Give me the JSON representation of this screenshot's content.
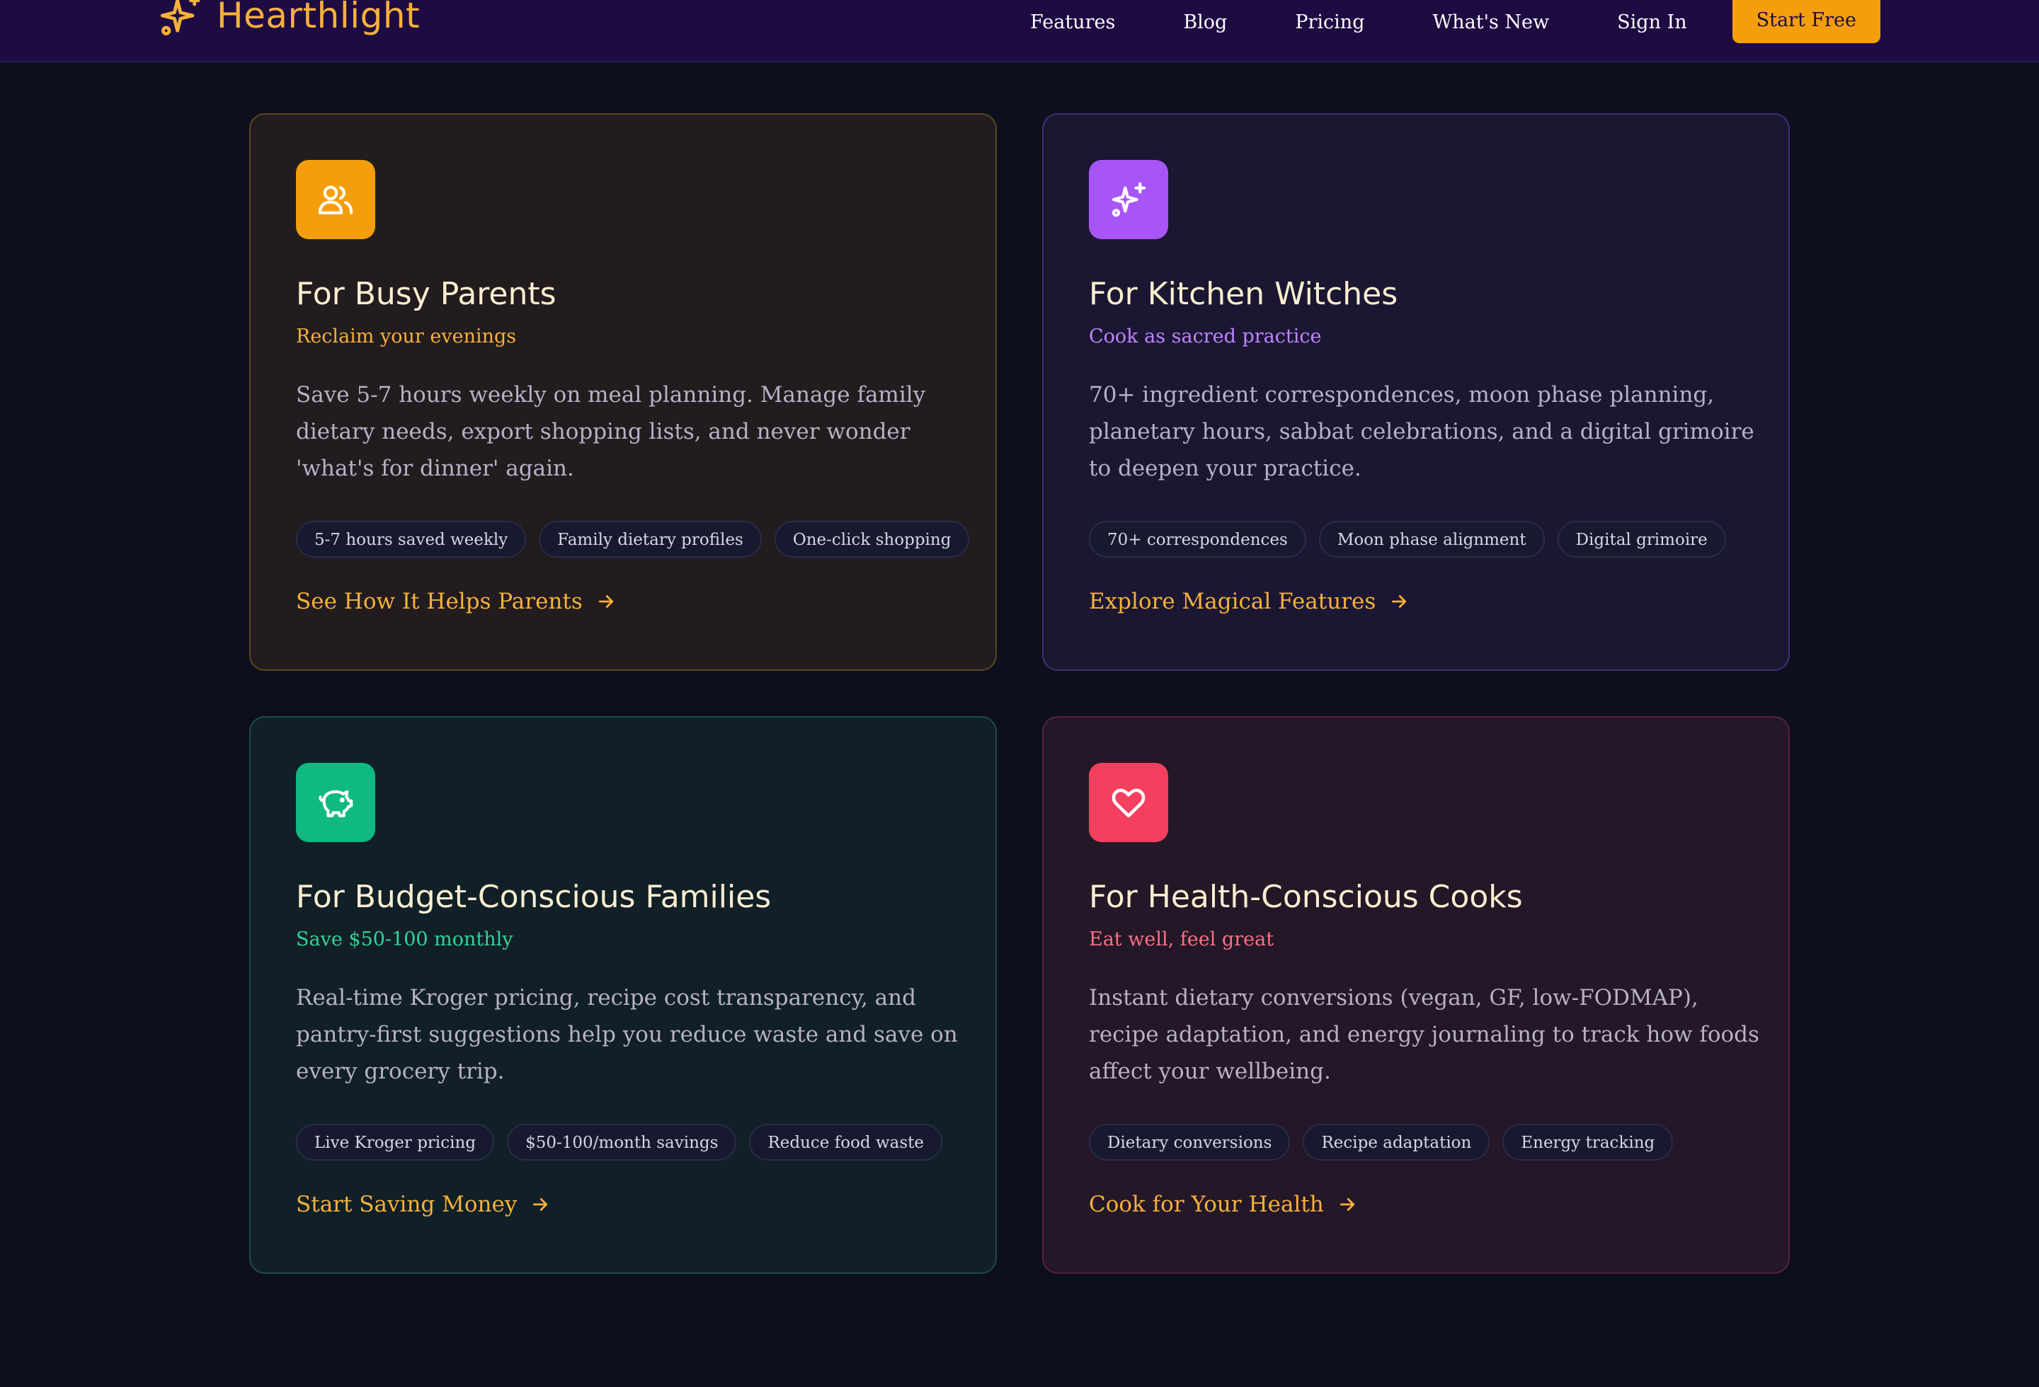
{
  "brand": {
    "name": "Hearthlight",
    "icon": "sparkle-icon",
    "color": "#f6b13a"
  },
  "nav": {
    "links": [
      "Features",
      "Blog",
      "Pricing",
      "What's New",
      "Sign In"
    ],
    "cta_label": "Start Free"
  },
  "colors": {
    "background": "#0d0f1f",
    "nav_background": "#1e0b42",
    "accent": "#f59e0b"
  },
  "cards": [
    {
      "icon": "users-icon",
      "icon_color": "#f59e0b",
      "title": "For Busy Parents",
      "subtitle": "Reclaim your evenings",
      "description": "Save 5-7 hours weekly on meal planning. Manage family dietary needs, export shopping lists, and never wonder 'what's for dinner' again.",
      "tags": [
        "5-7 hours saved weekly",
        "Family dietary profiles",
        "One-click shopping"
      ],
      "link": "See How It Helps Parents"
    },
    {
      "icon": "sparkles-icon",
      "icon_color": "#a855f7",
      "title": "For Kitchen Witches",
      "subtitle": "Cook as sacred practice",
      "description": "70+ ingredient correspondences, moon phase planning, planetary hours, sabbat celebrations, and a digital grimoire to deepen your practice.",
      "tags": [
        "70+ correspondences",
        "Moon phase alignment",
        "Digital grimoire"
      ],
      "link": "Explore Magical Features"
    },
    {
      "icon": "piggy-bank-icon",
      "icon_color": "#10b981",
      "title": "For Budget-Conscious Families",
      "subtitle": "Save $50-100 monthly",
      "description": "Real-time Kroger pricing, recipe cost transparency, and pantry-first suggestions help you reduce waste and save on every grocery trip.",
      "tags": [
        "Live Kroger pricing",
        "$50-100/month savings",
        "Reduce food waste"
      ],
      "link": "Start Saving Money"
    },
    {
      "icon": "heart-icon",
      "icon_color": "#f43f5e",
      "title": "For Health-Conscious Cooks",
      "subtitle": "Eat well, feel great",
      "description": "Instant dietary conversions (vegan, GF, low-FODMAP), recipe adaptation, and energy journaling to track how foods affect your wellbeing.",
      "tags": [
        "Dietary conversions",
        "Recipe adaptation",
        "Energy tracking"
      ],
      "link": "Cook for Your Health"
    }
  ]
}
